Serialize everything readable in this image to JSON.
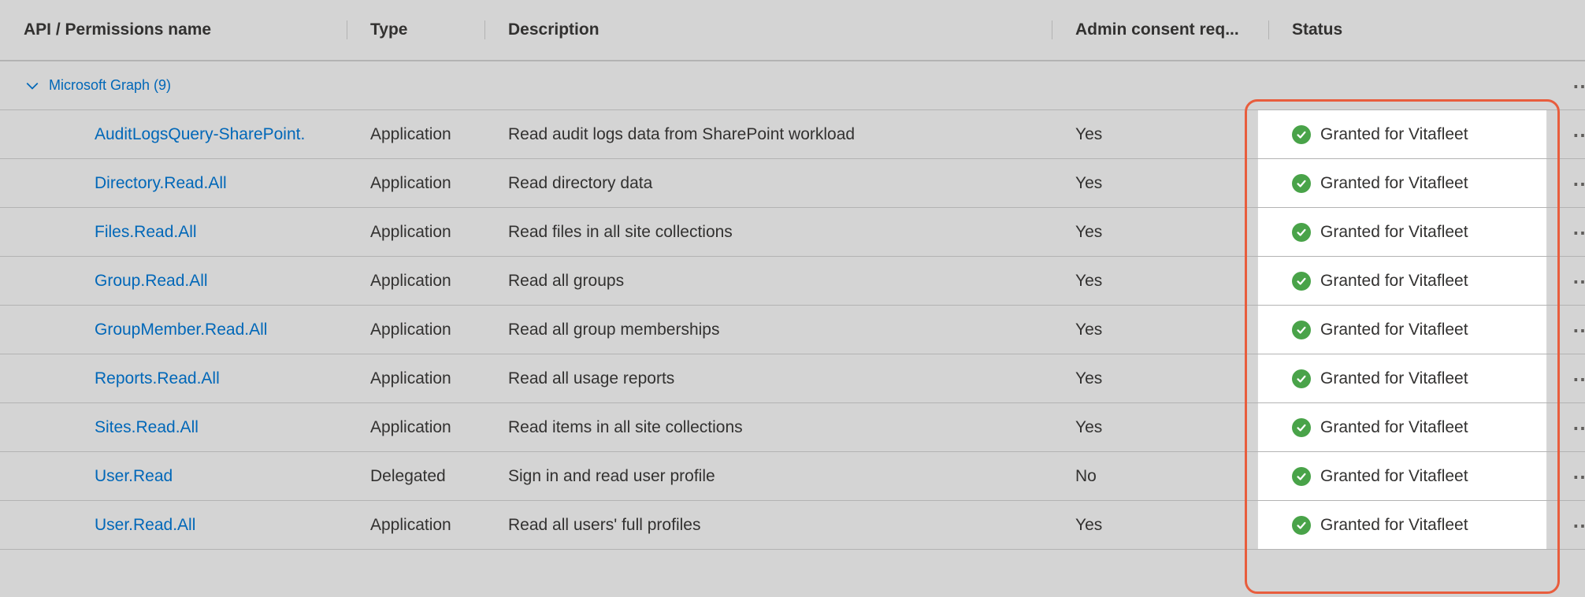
{
  "columns": {
    "name": "API / Permissions name",
    "type": "Type",
    "desc": "Description",
    "admin": "Admin consent req...",
    "status": "Status"
  },
  "category": {
    "label": "Microsoft Graph (9)"
  },
  "permissions": [
    {
      "name": "AuditLogsQuery-SharePoint.",
      "type": "Application",
      "desc": "Read audit logs data from SharePoint workload",
      "admin": "Yes",
      "status": "Granted for Vitafleet"
    },
    {
      "name": "Directory.Read.All",
      "type": "Application",
      "desc": "Read directory data",
      "admin": "Yes",
      "status": "Granted for Vitafleet"
    },
    {
      "name": "Files.Read.All",
      "type": "Application",
      "desc": "Read files in all site collections",
      "admin": "Yes",
      "status": "Granted for Vitafleet"
    },
    {
      "name": "Group.Read.All",
      "type": "Application",
      "desc": "Read all groups",
      "admin": "Yes",
      "status": "Granted for Vitafleet"
    },
    {
      "name": "GroupMember.Read.All",
      "type": "Application",
      "desc": "Read all group memberships",
      "admin": "Yes",
      "status": "Granted for Vitafleet"
    },
    {
      "name": "Reports.Read.All",
      "type": "Application",
      "desc": "Read all usage reports",
      "admin": "Yes",
      "status": "Granted for Vitafleet"
    },
    {
      "name": "Sites.Read.All",
      "type": "Application",
      "desc": "Read items in all site collections",
      "admin": "Yes",
      "status": "Granted for Vitafleet"
    },
    {
      "name": "User.Read",
      "type": "Delegated",
      "desc": "Sign in and read user profile",
      "admin": "No",
      "status": "Granted for Vitafleet"
    },
    {
      "name": "User.Read.All",
      "type": "Application",
      "desc": "Read all users' full profiles",
      "admin": "Yes",
      "status": "Granted for Vitafleet"
    }
  ]
}
